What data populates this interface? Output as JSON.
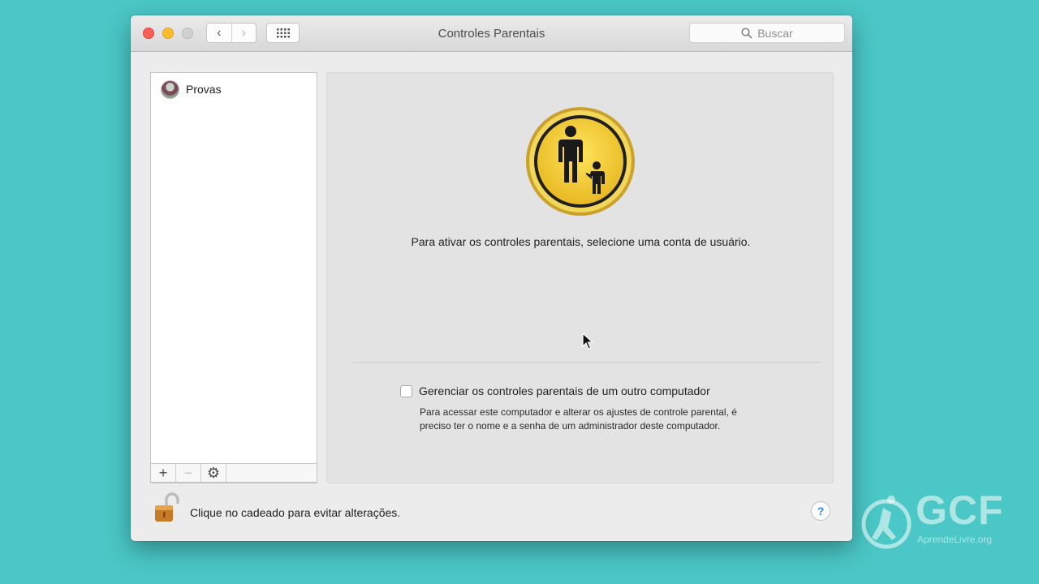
{
  "window": {
    "title": "Controles Parentais",
    "search_placeholder": "Buscar"
  },
  "sidebar": {
    "users": [
      {
        "name": "Provas"
      }
    ],
    "tools": [
      "+",
      "−",
      "⚙"
    ]
  },
  "main": {
    "message": "Para ativar os controles parentais, selecione uma conta de usuário.",
    "checkbox_label": "Gerenciar os controles parentais de um outro computador",
    "checkbox_checked": false,
    "checkbox_description": "Para acessar este computador e alterar os ajustes de controle parental, é preciso ter o nome e a senha de um administrador deste computador."
  },
  "footer": {
    "lock_text": "Clique no cadeado para evitar alterações.",
    "help_label": "?"
  },
  "watermark": {
    "brand": "GCF",
    "sub": "AprendeLivre.org"
  }
}
